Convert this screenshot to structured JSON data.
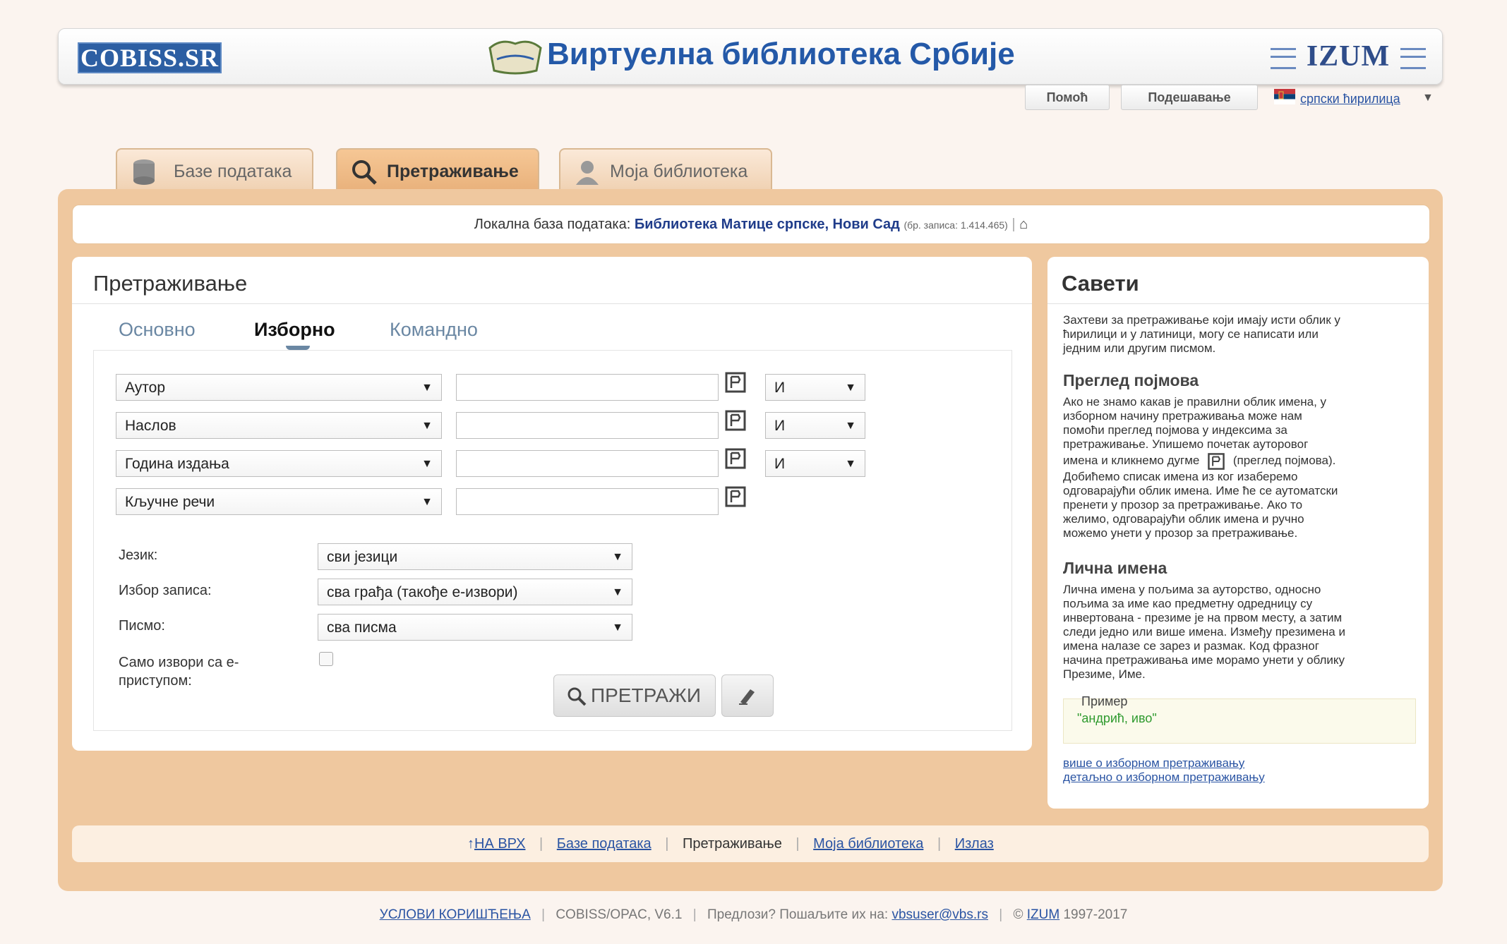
{
  "header": {
    "cobiss_logo": "COBISS.SR",
    "title": "Виртуелна библиотека Србије",
    "izum_logo": "IZUM"
  },
  "top_buttons": {
    "help": "Помоћ",
    "settings": "Подешавање",
    "language": "српски ћирилица"
  },
  "tabs": [
    {
      "label": "Базе података"
    },
    {
      "label": "Претраживање"
    },
    {
      "label": "Моја библиотека"
    }
  ],
  "local_db": {
    "label": "Локална база података:",
    "library": "Библиотека Матице српске, Нови Сад",
    "records": "(бр. записа: 1.414.465)",
    "separator": "|"
  },
  "search": {
    "title": "Претраживање",
    "subtabs": [
      "Основно",
      "Изборно",
      "Командно"
    ],
    "rows": [
      {
        "field": "Аутор",
        "value": "",
        "operator": "И"
      },
      {
        "field": "Наслов",
        "value": "",
        "operator": "И"
      },
      {
        "field": "Година издања",
        "value": "",
        "operator": "И"
      },
      {
        "field": "Кључне речи",
        "value": "",
        "operator": ""
      }
    ],
    "language_label": "Језик:",
    "language_value": "сви језици",
    "record_label": "Избор записа:",
    "record_value": "сва грађа (такође е-извори)",
    "script_label": "Писмо:",
    "script_value": "сва писма",
    "eaccess_label_1": "Само извори са е-",
    "eaccess_label_2": "приступом:",
    "search_button": "ПРЕТРАЖИ"
  },
  "tips": {
    "title": "Савети",
    "intro": [
      "Захтеви за претраживање који имају исти облик у",
      "ћирилици и у латиници, могу се написати или",
      "једним или другим писмом."
    ],
    "h1": "Преглед појмова",
    "p1": [
      "Ако не знамо какав је правилни облик имена, у",
      "изборном начину претраживања може нам",
      "помоћи преглед појмова у индексима за",
      "претраживање. Упишемо почетак ауторовог",
      "имена и кликнемо дугме",
      "(преглед појмова).",
      "Добићемо списак имена из ког изаберемо",
      "одговарајући облик имена. Име ће се аутоматски",
      "пренети у прозор за претраживање. Ако то",
      "желимо, одговарајући облик имена и ручно",
      "можемо унети у прозор за претраживање."
    ],
    "h2": "Лична имена",
    "p2": [
      "Лична имена у пољима за ауторство, односно",
      "пољима за име као предметну одредницу су",
      "инвертована - презиме је на првом месту, а затим",
      "следи једно или више имена. Између презимена и",
      "имена налазе се зарез и размак. Код фразног",
      "начина претраживања име морамо унети у облику",
      "Презиме, Име."
    ],
    "example_label": "Пример",
    "example_value": "\"андрић, иво\"",
    "link1": "више о изборном претраживању",
    "link2": "детаљно о изборном претраживању"
  },
  "bottom_nav": {
    "top": "НА ВРХ",
    "databases": "Базе података",
    "search": "Претраживање",
    "mylib": "Моја библиотека",
    "exit": "Излаз"
  },
  "footer": {
    "terms": "УСЛОВИ КОРИШЋЕЊА",
    "version": "COBISS/OPAC, V6.1",
    "suggest": "Предлози? Пошаљите их на:",
    "email": "vbsuser@vbs.rs",
    "copyright_sign": "©",
    "izum": "IZUM",
    "years": "1997-2017"
  },
  "colors": {
    "accent": "#2459a8",
    "frame": "#efc89f",
    "tab_active": "#e8b07a"
  }
}
